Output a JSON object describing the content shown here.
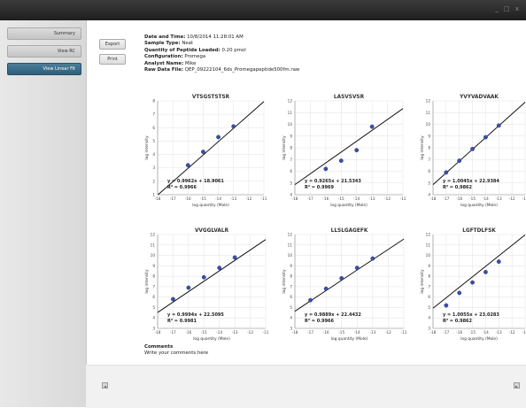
{
  "window": {
    "controls": "_ □ x"
  },
  "sidebar": {
    "items": [
      {
        "label": "Summary"
      },
      {
        "label": "View RC"
      },
      {
        "label": "View Linear Fit"
      }
    ]
  },
  "actions": {
    "export_label": "Export",
    "print_label": "Print"
  },
  "info": {
    "date_label": "Date and Time:",
    "date_value": "10/8/2014 11:28:01 AM",
    "sample_label": "Sample Type:",
    "sample_value": "Neat",
    "quantity_label": "Quantity of Peptide Loaded:",
    "quantity_value": "0.20 pmol",
    "config_label": "Configuration:",
    "config_value": "Promega",
    "analyst_label": "Analyst Name:",
    "analyst_value": "Mike",
    "raw_label": "Raw Data File:",
    "raw_value": "QEP_09222104_6ds_Promegapeptide500fm.raw"
  },
  "comments": {
    "heading": "Comments",
    "text": "Write your comments here"
  },
  "bottom": {
    "left_btn": "◄",
    "right_btn": "►"
  },
  "chart_data": [
    {
      "type": "scatter",
      "title": "VTSGSTSTSR",
      "xlabel": "log quantity (Mole)",
      "ylabel": "log intensity",
      "xlim": [
        -18,
        -11
      ],
      "ylim": [
        1,
        8
      ],
      "xticks": [
        -18,
        -17,
        -16,
        -15,
        -14,
        -13,
        -12,
        -11
      ],
      "yticks": [
        1,
        2,
        3,
        4,
        5,
        6,
        7,
        8
      ],
      "x": [
        -16,
        -15,
        -14,
        -13
      ],
      "y": [
        3.2,
        4.2,
        5.3,
        6.1
      ],
      "fit": {
        "slope": 0.9962,
        "intercept": 18.9061
      },
      "equation": "y = 0.9962x + 18.9061",
      "r2": "R² = 0.9966",
      "color": "#3b4fa8"
    },
    {
      "type": "scatter",
      "title": "LASVSVSR",
      "xlabel": "log quantity (Mole)",
      "ylabel": "log intensity",
      "xlim": [
        -18,
        -11
      ],
      "ylim": [
        4,
        12
      ],
      "xticks": [
        -18,
        -17,
        -16,
        -15,
        -14,
        -13,
        -12,
        -11
      ],
      "yticks": [
        4,
        5,
        6,
        7,
        8,
        9,
        10,
        11,
        12
      ],
      "x": [
        -16,
        -15,
        -14,
        -13
      ],
      "y": [
        6.2,
        6.9,
        7.8,
        9.8
      ],
      "fit": {
        "slope": 0.9265,
        "intercept": 21.5343
      },
      "equation": "y = 0.9265x + 21.5343",
      "r2": "R² = 0.9969",
      "color": "#3b4fa8"
    },
    {
      "type": "scatter",
      "title": "YVYVADVAAK",
      "xlabel": "log quantity (Mole)",
      "ylabel": "log intensity",
      "xlim": [
        -18,
        -11
      ],
      "ylim": [
        4,
        12
      ],
      "xticks": [
        -18,
        -17,
        -16,
        -15,
        -14,
        -13,
        -12,
        -11
      ],
      "yticks": [
        4,
        5,
        6,
        7,
        8,
        9,
        10,
        11,
        12
      ],
      "x": [
        -17,
        -16,
        -15,
        -14,
        -13
      ],
      "y": [
        5.9,
        6.9,
        7.9,
        8.9,
        9.9
      ],
      "fit": {
        "slope": 1.0045,
        "intercept": 22.9384
      },
      "equation": "y = 1.0045x + 22.9384",
      "r2": "R² = 0.9862",
      "color": "#3b4fa8"
    },
    {
      "type": "scatter",
      "title": "VVGGLVALR",
      "xlabel": "log quantity (Mole)",
      "ylabel": "log intensity",
      "xlim": [
        -18,
        -11
      ],
      "ylim": [
        3,
        12
      ],
      "xticks": [
        -18,
        -17,
        -16,
        -15,
        -14,
        -13,
        -12,
        -11
      ],
      "yticks": [
        3,
        4,
        5,
        6,
        7,
        8,
        9,
        10,
        11,
        12
      ],
      "x": [
        -17,
        -16,
        -15,
        -14,
        -13
      ],
      "y": [
        5.8,
        6.9,
        7.9,
        8.8,
        9.8
      ],
      "fit": {
        "slope": 0.9994,
        "intercept": 22.5095
      },
      "equation": "y = 0.9994x + 22.5095",
      "r2": "R² = 0.9981",
      "color": "#3b4fa8"
    },
    {
      "type": "scatter",
      "title": "LLSLGAGEFK",
      "xlabel": "log quantity (Mole)",
      "ylabel": "log intensity",
      "xlim": [
        -18,
        -11
      ],
      "ylim": [
        3,
        12
      ],
      "xticks": [
        -18,
        -17,
        -16,
        -15,
        -14,
        -13,
        -12,
        -11
      ],
      "yticks": [
        3,
        4,
        5,
        6,
        7,
        8,
        9,
        10,
        11,
        12
      ],
      "x": [
        -17,
        -16,
        -15,
        -14,
        -13
      ],
      "y": [
        5.7,
        6.8,
        7.8,
        8.8,
        9.7
      ],
      "fit": {
        "slope": 0.9889,
        "intercept": 22.4432
      },
      "equation": "y = 0.9889x + 22.4432",
      "r2": "R² = 0.9966",
      "color": "#3b4fa8"
    },
    {
      "type": "scatter",
      "title": "LGFTDLFSK",
      "xlabel": "log quantity (Mole)",
      "ylabel": "log intensity",
      "xlim": [
        -18,
        -11
      ],
      "ylim": [
        3,
        12
      ],
      "xticks": [
        -18,
        -17,
        -16,
        -15,
        -14,
        -13,
        -12,
        -11
      ],
      "yticks": [
        3,
        4,
        5,
        6,
        7,
        8,
        9,
        10,
        11,
        12
      ],
      "x": [
        -17,
        -16,
        -15,
        -14,
        -13
      ],
      "y": [
        5.2,
        6.4,
        7.4,
        8.4,
        9.4
      ],
      "fit": {
        "slope": 1.0055,
        "intercept": 23.0283
      },
      "equation": "y = 1.0055x + 23.0283",
      "r2": "R² = 0.9862",
      "color": "#3b4fa8"
    }
  ]
}
